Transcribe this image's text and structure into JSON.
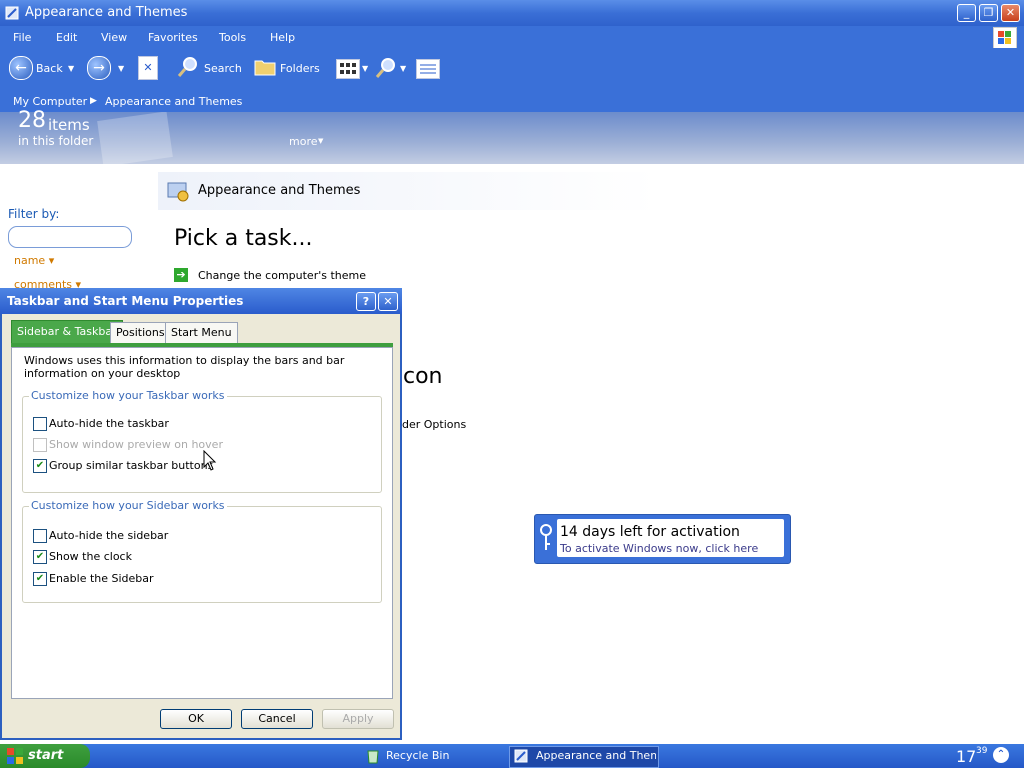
{
  "window": {
    "title": "Appearance and Themes"
  },
  "menu": [
    "File",
    "Edit",
    "View",
    "Favorites",
    "Tools",
    "Help"
  ],
  "toolbar": {
    "back": "Back",
    "search": "Search",
    "folders": "Folders"
  },
  "address": {
    "crumb1": "My Computer",
    "crumb2": "Appearance and Themes"
  },
  "header": {
    "count": "28",
    "items": "items",
    "sub": "in this folder",
    "more": "more"
  },
  "leftpane": {
    "filter_label": "Filter by:",
    "filter_placeholder": "",
    "sort_name": "name ▾",
    "sort_comments": "comments ▾"
  },
  "content": {
    "category_title": "Appearance and Themes",
    "pick_task": "Pick a task...",
    "task1": "Change the computer's theme",
    "partial_heading": "con",
    "partial_link": "der Options"
  },
  "dialog": {
    "title": "Taskbar and Start Menu Properties",
    "tabs": [
      "Sidebar & Taskbar",
      "Positions",
      "Start Menu"
    ],
    "description": "Windows uses this information to display the bars and bar information on your desktop",
    "taskbar_group": {
      "label": "Customize how your Taskbar works",
      "items": [
        {
          "label": "Auto-hide the taskbar",
          "checked": false,
          "disabled": false
        },
        {
          "label": "Show window preview on hover",
          "checked": false,
          "disabled": true
        },
        {
          "label": "Group similar taskbar buttons",
          "checked": true,
          "disabled": false
        }
      ]
    },
    "sidebar_group": {
      "label": "Customize how your Sidebar works",
      "items": [
        {
          "label": "Auto-hide the sidebar",
          "checked": false,
          "disabled": false
        },
        {
          "label": "Show the clock",
          "checked": true,
          "disabled": false
        },
        {
          "label": "Enable the Sidebar",
          "checked": true,
          "disabled": false
        }
      ]
    },
    "buttons": {
      "ok": "OK",
      "cancel": "Cancel",
      "apply": "Apply"
    }
  },
  "activation": {
    "title": "14 days left for activation",
    "subtitle": "To activate Windows now, click here"
  },
  "taskbar": {
    "start": "start",
    "items": [
      "Recycle Bin",
      "Appearance and Theme"
    ],
    "clock_hour": "17",
    "clock_min": "39"
  },
  "colors": {
    "accent_blue": "#3a70d8",
    "start_green": "#2a8a2a",
    "tab_green": "#4aa84a"
  }
}
